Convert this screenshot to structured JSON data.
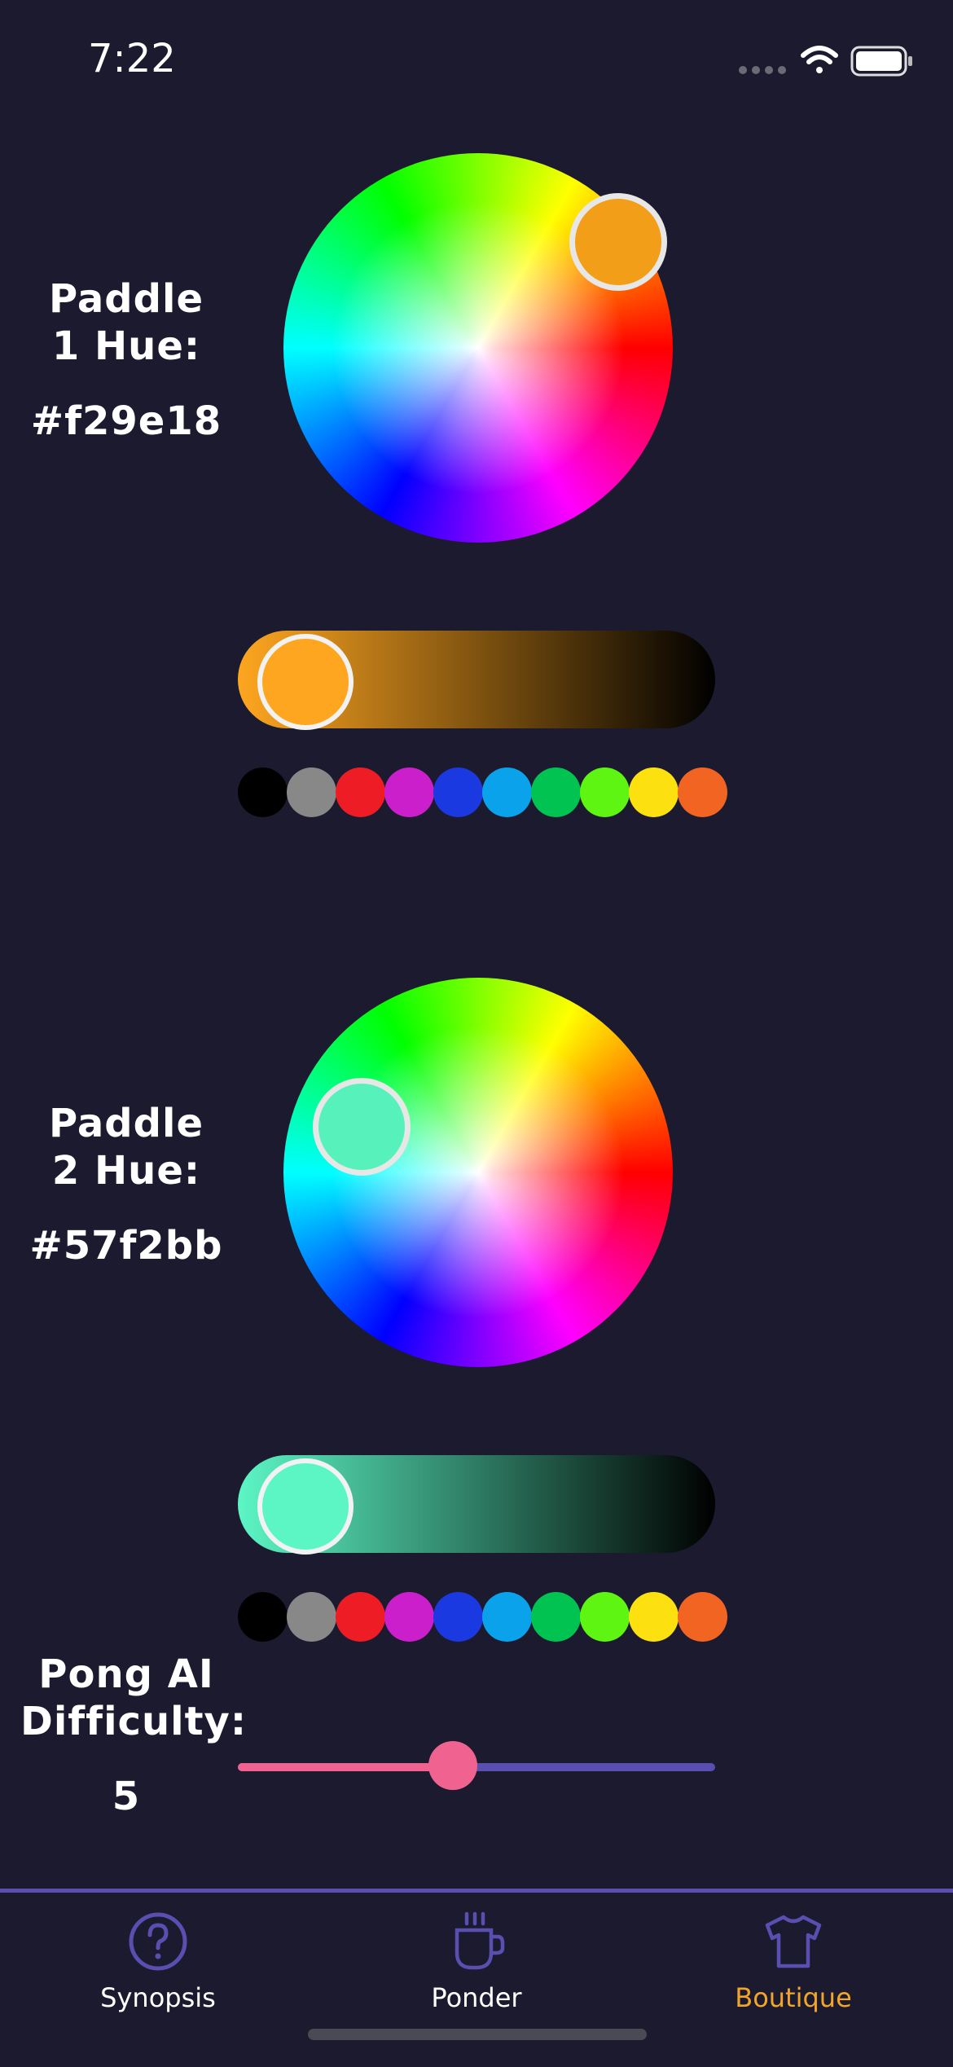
{
  "status_bar": {
    "time": "7:22"
  },
  "paddle1": {
    "title": "Paddle 1 Hue:",
    "hex": "#f29e18",
    "selected_color": "#f29e18",
    "brightness_color": "#ffa620",
    "brightness_level": 1.0
  },
  "paddle2": {
    "title": "Paddle 2 Hue:",
    "hex": "#57f2bb",
    "selected_color": "#57f2bb",
    "brightness_color": "#5cf6c5",
    "brightness_level": 1.0
  },
  "swatch_colors": [
    "#000000",
    "#888888",
    "#ee1c25",
    "#cc1fcc",
    "#1b39e0",
    "#0aa2ea",
    "#00c352",
    "#5df511",
    "#fde010",
    "#f26422"
  ],
  "difficulty": {
    "title": "Pong AI Difficulty:",
    "value": "5",
    "fraction": 0.45,
    "active_color": "#f06390",
    "track_color": "#5a4fb0"
  },
  "tabbar": {
    "tabs": [
      {
        "label": "Synopsis",
        "icon": "question-circle-icon",
        "active": false
      },
      {
        "label": "Ponder",
        "icon": "coffee-cup-icon",
        "active": false
      },
      {
        "label": "Boutique",
        "icon": "tshirt-icon",
        "active": true
      }
    ],
    "active_color": "#f3a52a",
    "inactive_icon_color": "#5a4fb0"
  }
}
